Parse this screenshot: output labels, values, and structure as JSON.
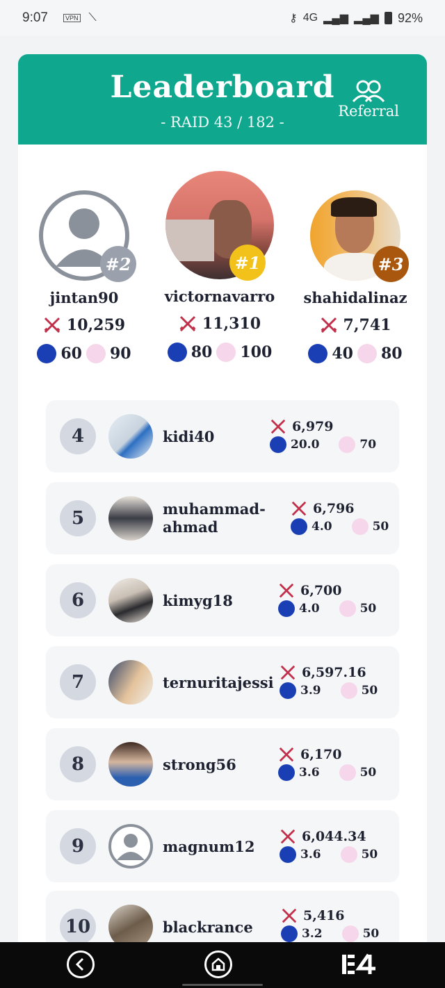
{
  "status_bar": {
    "time": "9:07",
    "vpn": "VPN",
    "network": "4G",
    "battery": "92%"
  },
  "header": {
    "title": "Leaderboard",
    "subtitle": "- RAID 43 / 182 -",
    "referral_label": "Referral",
    "color": "#0fa88e"
  },
  "podium": [
    {
      "rank": "#2",
      "name": "jintan90",
      "score": "10,259",
      "steem": "60",
      "sticker": "90",
      "badge_color": "#9aa1ac"
    },
    {
      "rank": "#1",
      "name": "victornavarro",
      "score": "11,310",
      "steem": "80",
      "sticker": "100",
      "badge_color": "#f2c21b"
    },
    {
      "rank": "#3",
      "name": "shahidalinaz",
      "score": "7,741",
      "steem": "40",
      "sticker": "80",
      "badge_color": "#a9560f"
    }
  ],
  "rows": [
    {
      "rank": "4",
      "name": "kidi40",
      "name2": "",
      "score": "6,979",
      "steem": "20.0",
      "sticker": "70"
    },
    {
      "rank": "5",
      "name": "muhammad-",
      "name2": "ahmad",
      "score": "6,796",
      "steem": "4.0",
      "sticker": "50"
    },
    {
      "rank": "6",
      "name": "kimyg18",
      "name2": "",
      "score": "6,700",
      "steem": "4.0",
      "sticker": "50"
    },
    {
      "rank": "7",
      "name": "ternuritajessi",
      "name2": "",
      "score": "6,597.16",
      "steem": "3.9",
      "sticker": "50"
    },
    {
      "rank": "8",
      "name": "strong56",
      "name2": "",
      "score": "6,170",
      "steem": "3.6",
      "sticker": "50"
    },
    {
      "rank": "9",
      "name": "magnum12",
      "name2": "",
      "score": "6,044.34",
      "steem": "3.6",
      "sticker": "50"
    },
    {
      "rank": "10",
      "name": "blackrance",
      "name2": "",
      "score": "5,416",
      "steem": "3.2",
      "sticker": "50"
    }
  ],
  "nav": {
    "back": "back-icon",
    "home": "home-icon",
    "recents": "recents-icon"
  }
}
